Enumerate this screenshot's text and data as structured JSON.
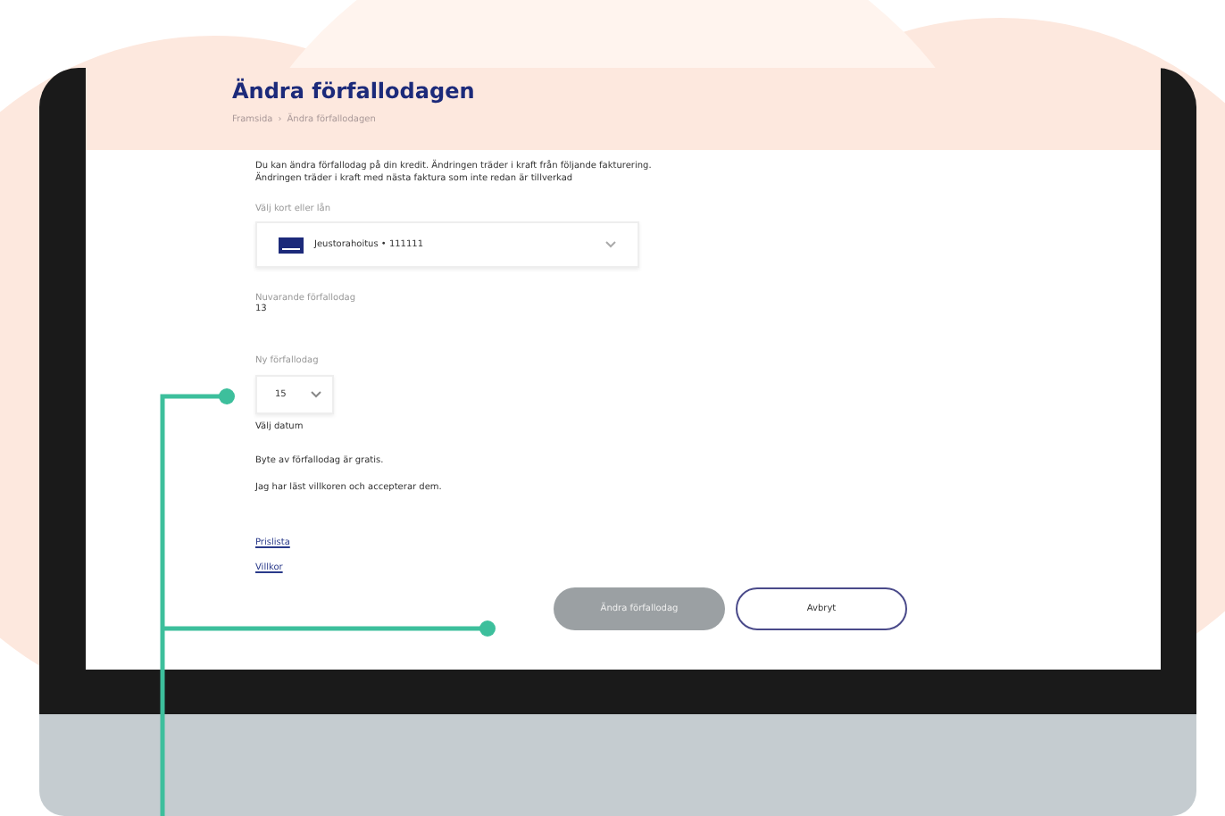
{
  "page": {
    "title": "Ändra förfallodagen",
    "breadcrumb": [
      "Framsida",
      "›",
      "Ändra förfallodagen"
    ],
    "intro": [
      "Du kan ändra förfallodag på din kredit. Ändringen träder i kraft från följande fakturering.",
      "Ändringen träder i kraft med nästa faktura som inte redan är tillverkad"
    ],
    "account_select": {
      "label": "Välj kort eller lån",
      "value": "Jeustorahoitus • 111111"
    },
    "current_due": {
      "label": "Nuvarande förfallodag",
      "value": "13"
    },
    "new_due": {
      "label": "Ny förfallodag",
      "value": "15",
      "hint": "Välj datum"
    },
    "notes": [
      "Byte av förfallodag är gratis.",
      "Jag har läst villkoren och accepterar dem."
    ],
    "links": [
      "Prislista",
      "Villkor"
    ],
    "buttons": [
      {
        "label": "Ändra förfallodag",
        "kind": "primary",
        "disabled": true
      },
      {
        "label": "Avbryt",
        "kind": "secondary",
        "disabled": false
      }
    ]
  }
}
